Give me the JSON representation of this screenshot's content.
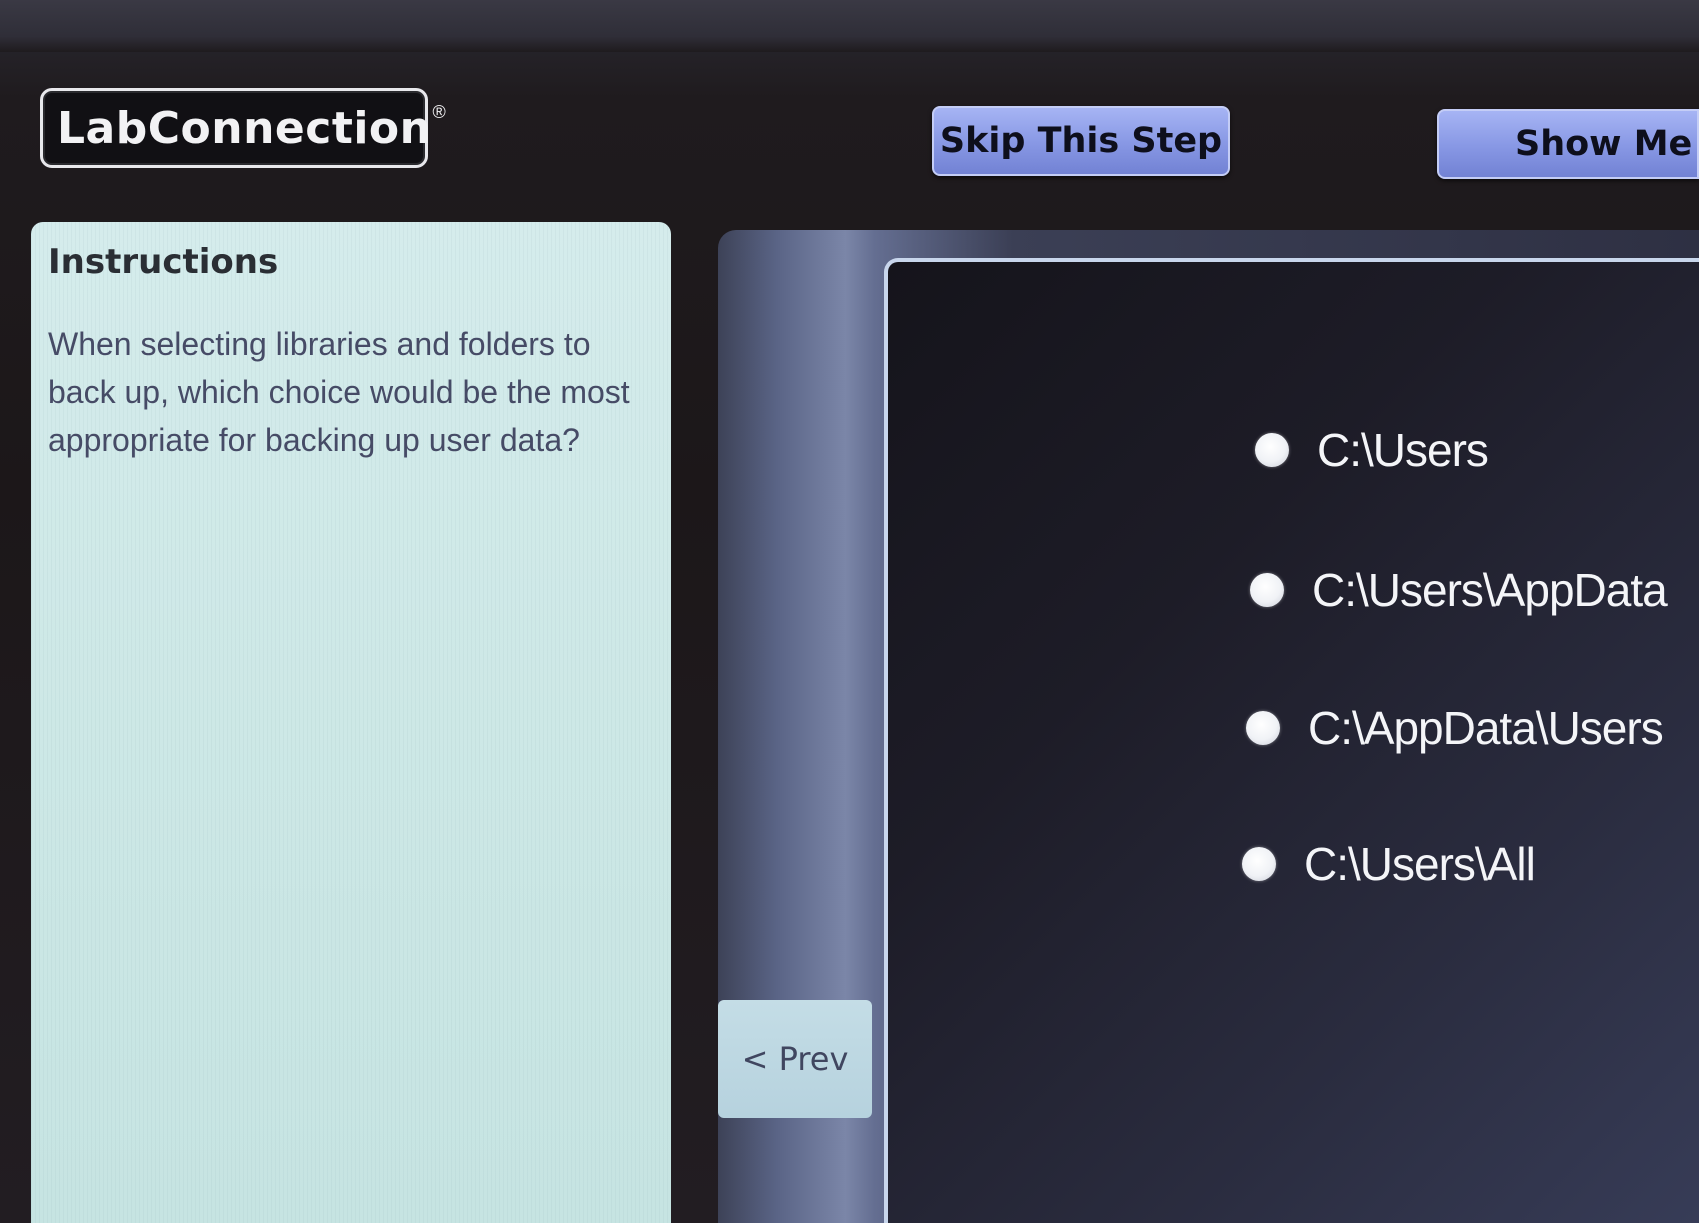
{
  "header": {
    "logo_text": "LabConnection",
    "logo_mark": "®",
    "skip_button": "Skip This Step",
    "show_me_button": "Show Me"
  },
  "instructions": {
    "title": "Instructions",
    "text": "When selecting libraries and folders to back up, which choice would be the most appropriate for backing up user data?"
  },
  "navigation": {
    "prev_button": "< Prev"
  },
  "question": {
    "options": [
      {
        "label": "C:\\Users"
      },
      {
        "label": "C:\\Users\\AppData"
      },
      {
        "label": "C:\\AppData\\Users"
      },
      {
        "label": "C:\\Users\\All"
      }
    ]
  },
  "colors": {
    "button_accent": "#8797e4",
    "instructions_bg": "#cfe9e8",
    "question_bg": "#1d1c27"
  }
}
